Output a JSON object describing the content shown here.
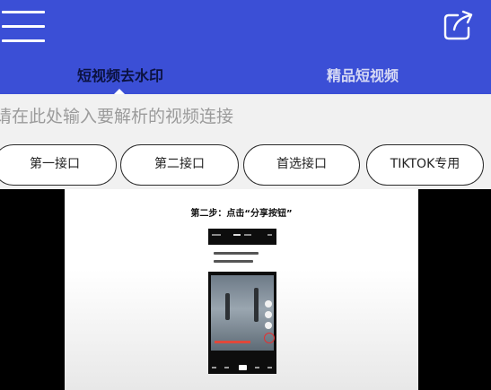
{
  "header": {
    "menu_icon": "hamburger-menu-icon",
    "share_icon": "share-export-icon",
    "background_color": "#3b4fd6"
  },
  "tabs": [
    {
      "label": "短视频去水印",
      "active": true
    },
    {
      "label": "精品短视频",
      "active": false
    }
  ],
  "search": {
    "placeholder": "请在此处输入要解析的视频连接",
    "value": ""
  },
  "interfaces": [
    {
      "label": "第一接口"
    },
    {
      "label": "第二接口"
    },
    {
      "label": "首选接口"
    },
    {
      "label": "TIKTOK专用"
    }
  ],
  "tutorial": {
    "caption": "第二步：点击“分享按钮”"
  }
}
